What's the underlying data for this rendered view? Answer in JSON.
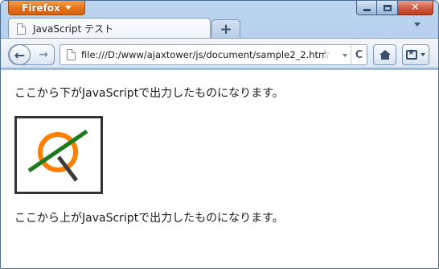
{
  "window": {
    "app_menu_label": "Firefox",
    "close_glyph": "✕"
  },
  "tabs": [
    {
      "title": "JavaScript テスト"
    }
  ],
  "new_tab_glyph": "+",
  "nav": {
    "url": "file:///D:/www/ajaxtower/js/document/sample2_2.htm",
    "back_glyph": "←",
    "forward_glyph": "→",
    "reload_glyph": "C",
    "star_glyph": "☆"
  },
  "content": {
    "line_before": "ここから下がJavaScriptで出力したものになります。",
    "line_after": "ここから上がJavaScriptで出力したものになります。"
  },
  "colors": {
    "circle": "#ff7f00",
    "green_line": "#1f7a1f",
    "dark_line": "#3a3a3a",
    "frame": "#333333"
  }
}
